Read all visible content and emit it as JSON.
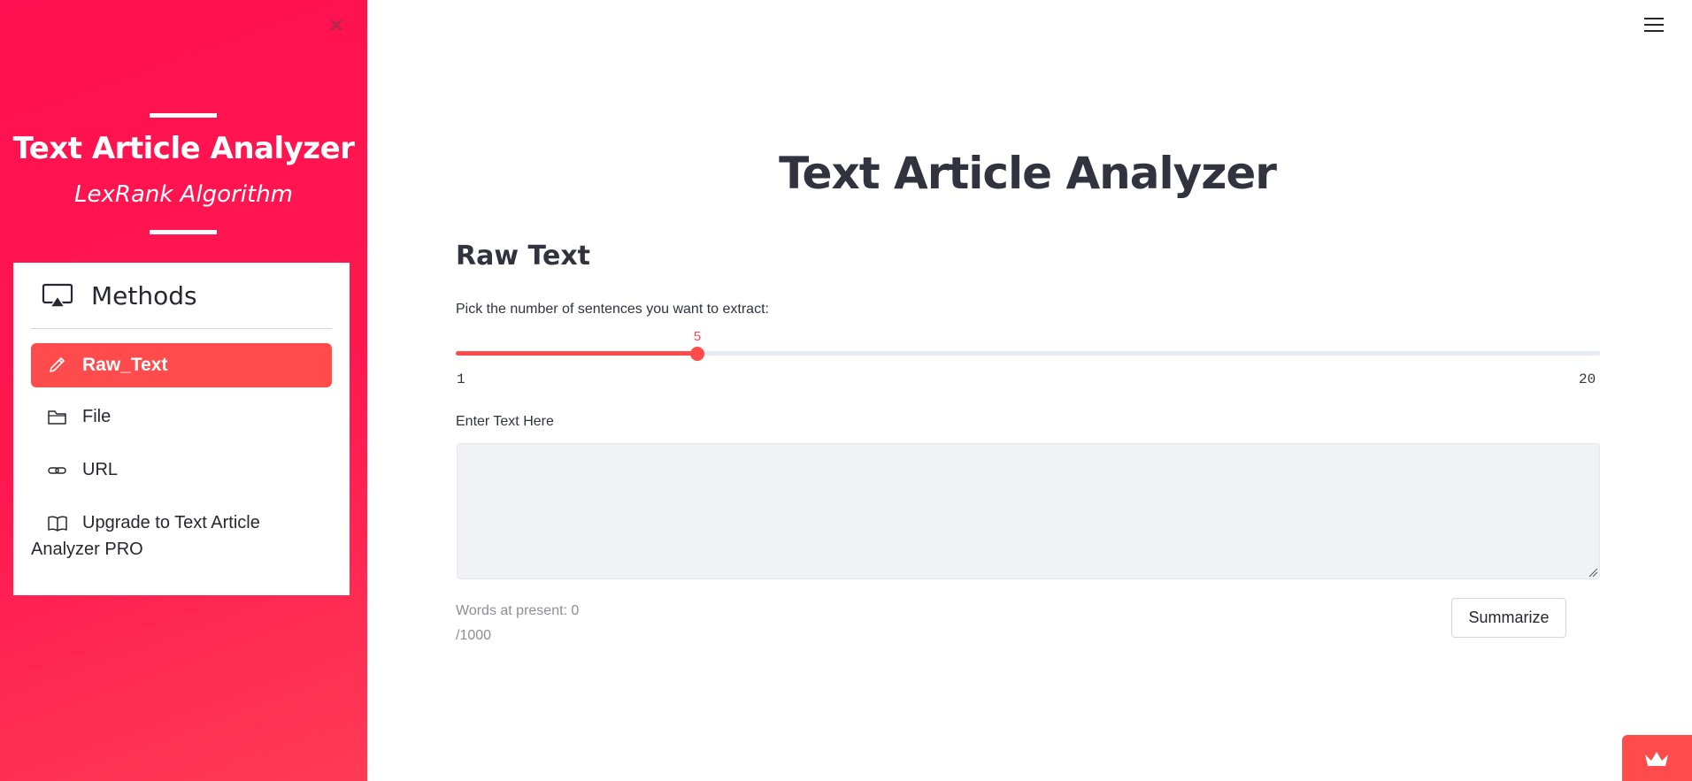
{
  "sidebar": {
    "close_symbol": "×",
    "title": "Text Article Analyzer",
    "subtitle": "LexRank Algorithm",
    "menu": {
      "title": "Methods",
      "header_icon": "airplay-icon",
      "items": [
        {
          "label": "Raw_Text",
          "icon": "pencil-icon",
          "active": true
        },
        {
          "label": "File",
          "icon": "folder-icon",
          "active": false
        },
        {
          "label": "URL",
          "icon": "link-icon",
          "active": false
        },
        {
          "label_line1": "Upgrade to Text Article",
          "label_line2": "Analyzer PRO",
          "icon": "book-icon",
          "active": false
        }
      ]
    }
  },
  "main": {
    "title": "Text Article Analyzer",
    "section_title": "Raw Text",
    "slider": {
      "label": "Pick the number of sentences you want to extract:",
      "value": "5",
      "min": "1",
      "max": "20"
    },
    "textarea": {
      "label": "Enter Text Here",
      "value": "",
      "placeholder": ""
    },
    "words_count": "Words at present: 0",
    "words_limit": "/1000",
    "summarize_label": "Summarize"
  },
  "colors": {
    "sidebar_bg": "#ff1950",
    "accent": "#ff4b4b",
    "text": "#31333f"
  }
}
